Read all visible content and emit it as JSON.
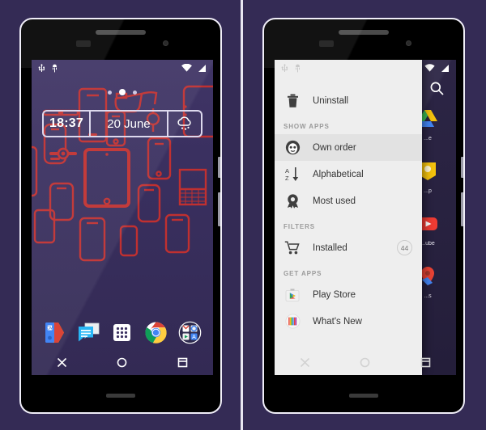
{
  "page": {
    "background_color": "#342b55",
    "divider_color": "#e8e6f2"
  },
  "phones": {
    "left": {
      "name": "home-screen-phone",
      "status_bar": {
        "left_icons": [
          "usb-icon",
          "usb-debug-icon"
        ],
        "right_icons": [
          "wifi-icon",
          "signal-icon"
        ]
      },
      "page_indicator": {
        "total": 3,
        "active_index": 1
      },
      "widget": {
        "time": "18:37",
        "date": "20 June",
        "weather_icon": "cloud-rain-icon"
      },
      "wallpaper": {
        "description": "red device outline pattern",
        "line_color": "#c03030",
        "background_color": "#3a3060"
      },
      "dock": [
        {
          "name": "dock-item-contacts",
          "label": "Contacts"
        },
        {
          "name": "dock-item-messaging",
          "label": "Messaging"
        },
        {
          "name": "dock-item-app-drawer",
          "label": "Apps"
        },
        {
          "name": "dock-item-chrome",
          "label": "Chrome"
        },
        {
          "name": "dock-item-google-folder",
          "label": "Google"
        }
      ],
      "nav_bar": [
        {
          "name": "nav-back-button",
          "icon": "close-x-icon"
        },
        {
          "name": "nav-home-button",
          "icon": "circle-icon"
        },
        {
          "name": "nav-recents-button",
          "icon": "square-recents-icon"
        }
      ]
    },
    "right": {
      "name": "app-drawer-menu-phone",
      "status_bar": {
        "left_icons": [
          "usb-icon",
          "usb-debug-icon"
        ],
        "right_icons": [
          "wifi-icon",
          "signal-icon"
        ]
      },
      "search_icon": "search-icon",
      "background_apps": [
        {
          "name": "app-drive",
          "label": "...e"
        },
        {
          "name": "app-keep",
          "label": "...p"
        },
        {
          "name": "app-youtube",
          "label": "...ube"
        },
        {
          "name": "app-maps",
          "label": "...s"
        }
      ],
      "nav_bar": [
        {
          "name": "nav-back-button",
          "icon": "close-x-icon"
        },
        {
          "name": "nav-home-button",
          "icon": "circle-icon"
        },
        {
          "name": "nav-recents-button",
          "icon": "square-recents-icon"
        }
      ]
    }
  },
  "drawer": {
    "uninstall": {
      "label": "Uninstall",
      "icon": "trash-icon"
    },
    "sections": [
      {
        "header": "SHOW APPS",
        "items": [
          {
            "label": "Own order",
            "icon": "face-icon",
            "active": true,
            "badge": null
          },
          {
            "label": "Alphabetical",
            "icon": "sort-az-icon",
            "active": false,
            "badge": null
          },
          {
            "label": "Most used",
            "icon": "award-icon",
            "active": false,
            "badge": null
          }
        ]
      },
      {
        "header": "FILTERS",
        "items": [
          {
            "label": "Installed",
            "icon": "cart-icon",
            "active": false,
            "badge": "44"
          }
        ]
      },
      {
        "header": "GET APPS",
        "items": [
          {
            "label": "Play Store",
            "icon": "play-store-icon",
            "active": false,
            "badge": null
          },
          {
            "label": "What's New",
            "icon": "whats-new-icon",
            "active": false,
            "badge": null
          }
        ]
      }
    ]
  }
}
